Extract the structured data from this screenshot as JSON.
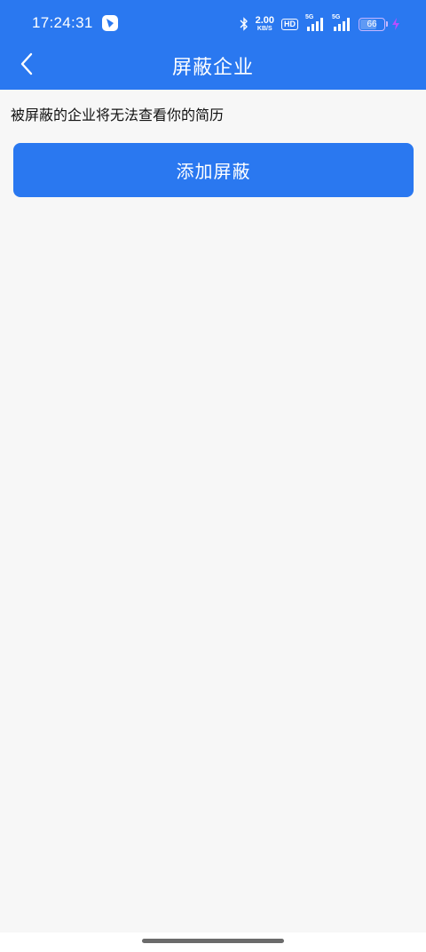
{
  "status_bar": {
    "time": "17:24:31",
    "net_speed_value": "2.00",
    "net_speed_unit": "KB/S",
    "hd_label": "HD",
    "signal_1_label": "5G",
    "signal_2_label": "5G",
    "battery_percent": "66",
    "icons": [
      "app-notification-icon",
      "bluetooth-icon",
      "signal-icon",
      "signal-icon",
      "battery-icon",
      "charging-icon"
    ]
  },
  "nav": {
    "title": "屏蔽企业",
    "back_icon": "chevron-left-icon"
  },
  "main": {
    "hint": "被屏蔽的企业将无法查看你的简历",
    "add_button_label": "添加屏蔽"
  },
  "colors": {
    "primary": "#2a78f0",
    "background": "#f7f7f7",
    "text": "#111111"
  }
}
